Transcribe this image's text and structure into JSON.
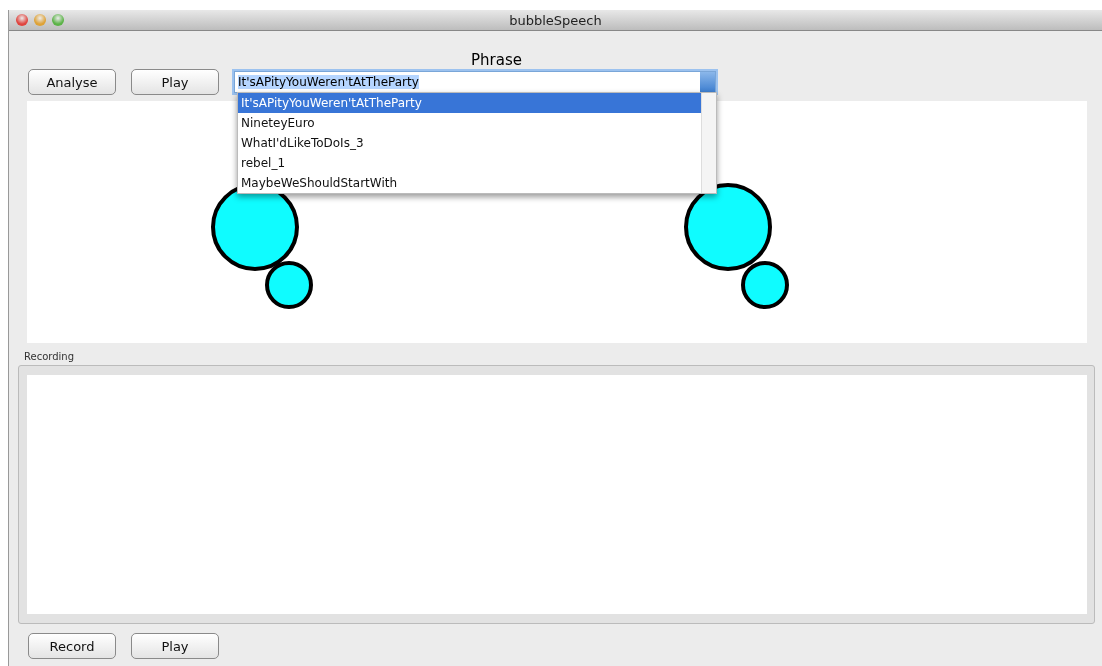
{
  "window": {
    "title": "bubbleSpeech"
  },
  "phrase": {
    "label": "Phrase",
    "value": "It'sAPityYouWeren'tAtTheParty",
    "expanded": true,
    "options": [
      {
        "label": "It'sAPityYouWeren'tAtTheParty",
        "selected": true
      },
      {
        "label": "NineteyEuro",
        "selected": false
      },
      {
        "label": "WhatI'dLikeToDoIs_3",
        "selected": false
      },
      {
        "label": "rebel_1",
        "selected": false
      },
      {
        "label": "MaybeWeShouldStartWith",
        "selected": false
      }
    ]
  },
  "top_buttons": [
    "Analyse",
    "Play"
  ],
  "recording": {
    "label": "Recording"
  },
  "bottom_buttons": [
    "Record",
    "Play"
  ]
}
